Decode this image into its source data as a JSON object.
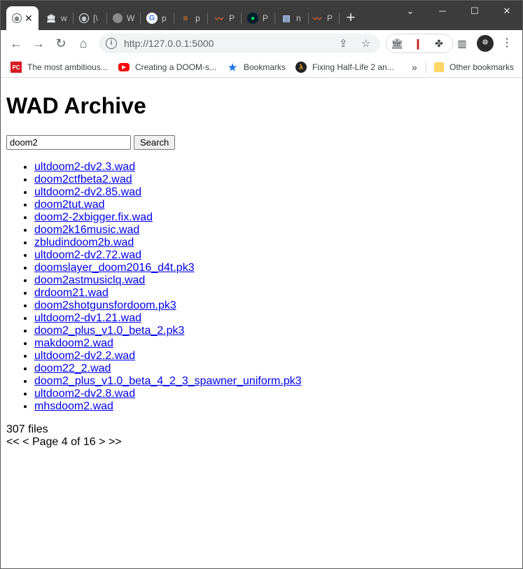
{
  "browser": {
    "tabs": [
      {
        "label": "",
        "favicon": "globe-icon"
      },
      {
        "label": "w",
        "favicon": "museum-icon"
      },
      {
        "label": "[\\",
        "favicon": "globe-icon"
      },
      {
        "label": "W",
        "favicon": "globe-icon"
      },
      {
        "label": "p",
        "favicon": "google-icon"
      },
      {
        "label": "p",
        "favicon": "stackoverflow-icon"
      },
      {
        "label": "P",
        "favicon": "doom-icon"
      },
      {
        "label": "P",
        "favicon": "mongodb-icon"
      },
      {
        "label": "n",
        "favicon": "book-icon"
      },
      {
        "label": "P",
        "favicon": "doom-icon"
      }
    ],
    "address": "http://127.0.0.1:5000",
    "bookmarks": [
      {
        "label": "The most ambitious...",
        "icon": "pcgamer-icon"
      },
      {
        "label": "Creating a DOOM-s...",
        "icon": "youtube-icon"
      },
      {
        "label": "Bookmarks",
        "icon": "star-icon"
      },
      {
        "label": "Fixing Half-Life 2 an...",
        "icon": "halflife-icon"
      }
    ],
    "overflow_label": "»",
    "other_bookmarks": "Other bookmarks",
    "colors": {
      "tabstrip": "#3c3c3c",
      "link": "#0000ee"
    }
  },
  "page": {
    "title": "WAD Archive",
    "search": {
      "value": "doom2",
      "button": "Search"
    },
    "files": [
      "ultdoom2-dv2.3.wad",
      "doom2ctfbeta2.wad",
      "ultdoom2-dv2.85.wad",
      "doom2tut.wad",
      "doom2-2xbigger.fix.wad",
      "doom2k16music.wad",
      "zbludindoom2b.wad",
      "ultdoom2-dv2.72.wad",
      "doomslayer_doom2016_d4t.pk3",
      "doom2astmusiclq.wad",
      "drdoom21.wad",
      "doom2shotgunsfordoom.pk3",
      "ultdoom2-dv1.21.wad",
      "doom2_plus_v1.0_beta_2.pk3",
      "makdoom2.wad",
      "ultdoom2-dv2.2.wad",
      "doom22_2.wad",
      "doom2_plus_v1.0_beta_4_2_3_spawner_uniform.pk3",
      "ultdoom2-dv2.8.wad",
      "mhsdoom2.wad"
    ],
    "file_count": "307 files",
    "pager": {
      "first": "<<",
      "prev": "<",
      "text": "Page 4 of 16",
      "next": ">",
      "last": ">>"
    }
  }
}
